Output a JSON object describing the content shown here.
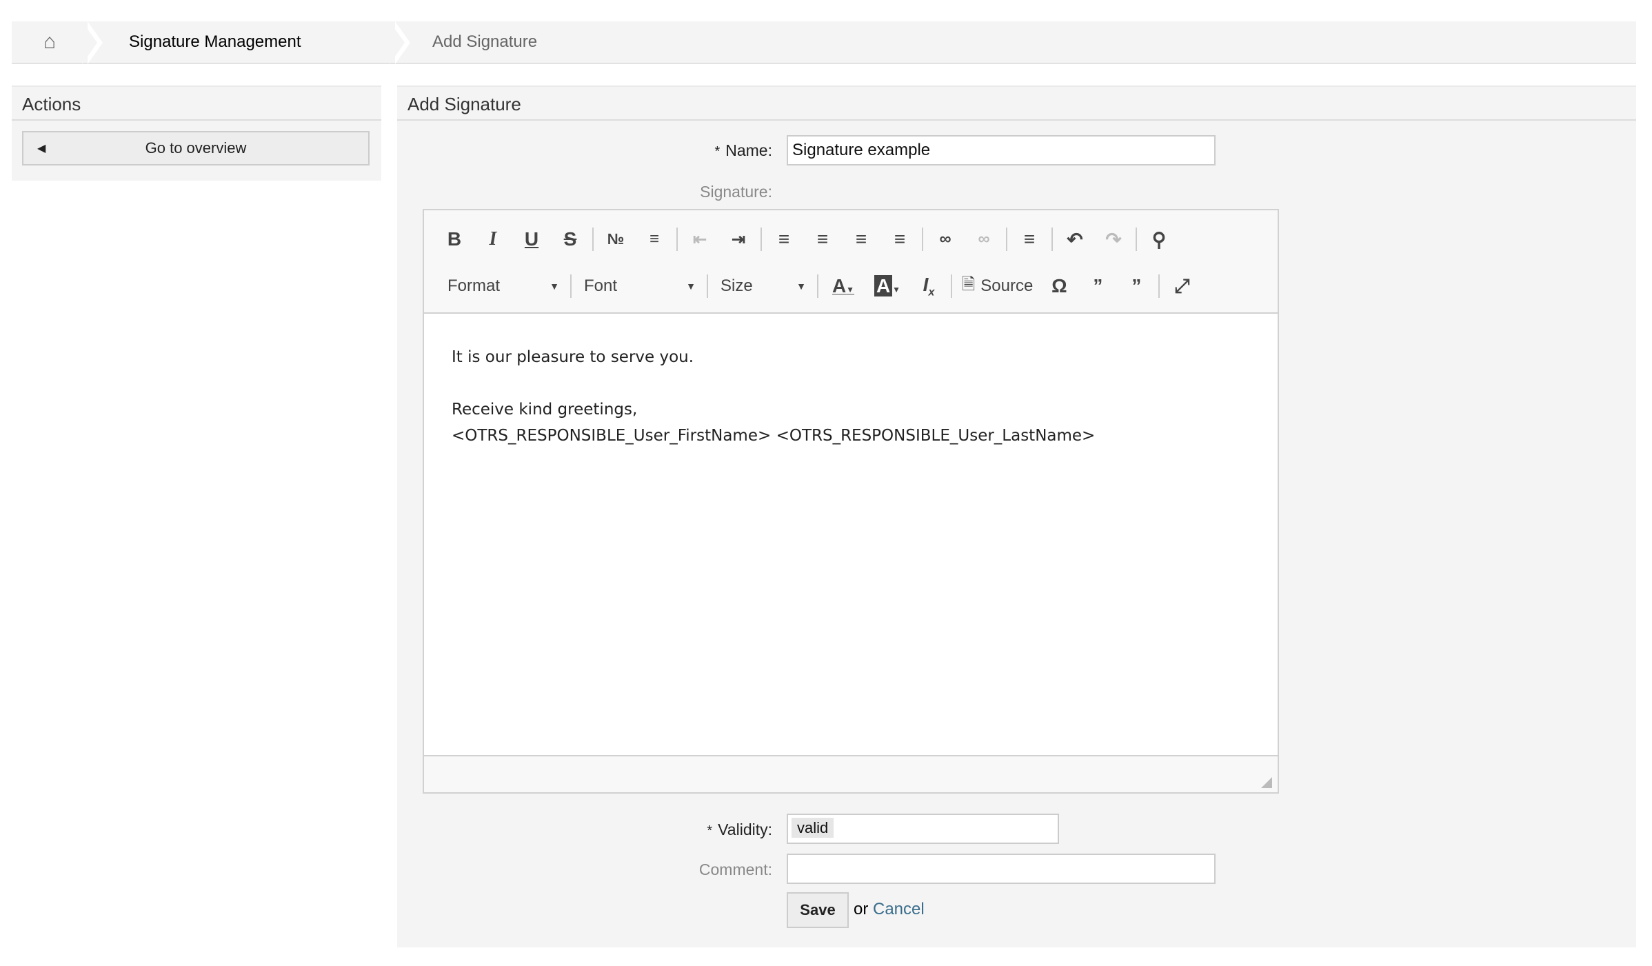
{
  "breadcrumb": {
    "home_icon": "home-icon",
    "items": [
      "Signature Management",
      "Add Signature"
    ]
  },
  "sidebar": {
    "title": "Actions",
    "overview_button": "Go to overview"
  },
  "main": {
    "title": "Add Signature",
    "form": {
      "name_label": "Name:",
      "name_value": "Signature example",
      "signature_label": "Signature:",
      "validity_label": "Validity:",
      "validity_value": "valid",
      "comment_label": "Comment:",
      "comment_value": "",
      "save": "Save",
      "or": "or",
      "cancel": "Cancel",
      "required_mark": "*"
    }
  },
  "editor": {
    "toolbar_row1": [
      "bold",
      "italic",
      "underline",
      "strikethrough",
      "numbered-list",
      "bulleted-list",
      "outdent",
      "indent",
      "align-left",
      "align-center",
      "align-right",
      "justify",
      "link",
      "unlink",
      "horizontal-line",
      "undo",
      "redo",
      "find"
    ],
    "format": "Format",
    "font": "Font",
    "size": "Size",
    "source": "Source",
    "content": [
      "It is our pleasure to serve you.",
      "",
      "Receive kind greetings,",
      "<OTRS_RESPONSIBLE_User_FirstName> <OTRS_RESPONSIBLE_User_LastName>"
    ]
  },
  "colors": {
    "link": "#3a6d8c",
    "panel": "#f4f4f4"
  }
}
